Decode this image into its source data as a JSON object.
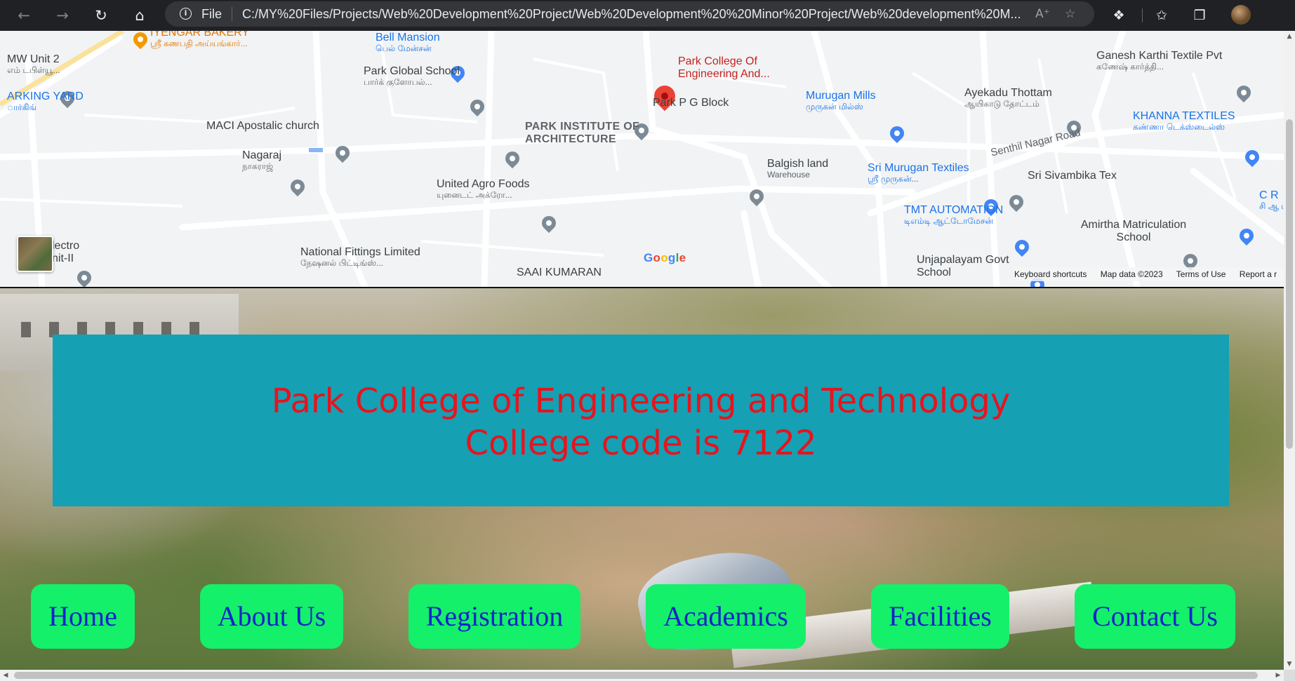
{
  "browser": {
    "scheme": "File",
    "url": "C:/MY%20Files/Projects/Web%20Development%20Project/Web%20Development%20%20Minor%20Project/Web%20development%20M...",
    "icons": [
      "back-icon",
      "forward-icon",
      "refresh-icon",
      "home-icon",
      "info-icon",
      "read-aloud-icon",
      "add-favorite-icon",
      "extensions-icon",
      "favorites-icon",
      "collections-icon",
      "profile-avatar"
    ]
  },
  "map": {
    "places": [
      {
        "name": "IYENGAR BAKERY",
        "sub": "ஸ்ரீ கணபதி அய்யங்கார்..."
      },
      {
        "name": "MW Unit 2",
        "sub": "எம் டபிள்யூ..."
      },
      {
        "name": "ARKING YARD",
        "sub": "ார்கிங்"
      },
      {
        "name": "Bell Mansion",
        "sub": "பெல் மேன்சன்"
      },
      {
        "name": "Park Global School",
        "sub": "பார்க் குளோபல்..."
      },
      {
        "name": "MACI Apostalic church",
        "sub": ""
      },
      {
        "name": "Nagaraj",
        "sub": "நாகராஜ்"
      },
      {
        "name": "PARK INSTITUTE OF ARCHITECTURE",
        "sub": ""
      },
      {
        "name": "United Agro Foods",
        "sub": "யுனைடட் அக்ரோ..."
      },
      {
        "name": "National Fittings Limited",
        "sub": "நேஷனல் பிட்டிங்ஸ்..."
      },
      {
        "name": "SAAI KUMARAN",
        "sub": ""
      },
      {
        "name": "Park College Of Engineering And...",
        "sub": ""
      },
      {
        "name": "Park P G Block",
        "sub": ""
      },
      {
        "name": "Murugan Mills",
        "sub": "முருகன் மில்ஸ்"
      },
      {
        "name": "Balgish land",
        "sub": "Warehouse"
      },
      {
        "name": "Sri Murugan Textiles",
        "sub": "ஸ்ரீ முருகன்..."
      },
      {
        "name": "TMT AUTOMATION",
        "sub": "டிஎம்டி ஆட்டோமேசன்"
      },
      {
        "name": "Unjapalayam Govt School",
        "sub": ""
      },
      {
        "name": "Ayekadu Thottam",
        "sub": "ஆயிகாடு தோட்டம்"
      },
      {
        "name": "Sri Sivambika Tex",
        "sub": ""
      },
      {
        "name": "Ganesh Karthi Textile Pvt",
        "sub": "கணேஷ் கார்த்தி..."
      },
      {
        "name": "KHANNA TEXTILES",
        "sub": "கண்ணா டெக்ஸ்டைல்ஸ்"
      },
      {
        "name": "Amirtha Matriculation School",
        "sub": ""
      },
      {
        "name": "C R",
        "sub": "சி ஆ மில்"
      },
      {
        "name": "lectro nit-II",
        "sub": ""
      }
    ],
    "road_label": "Senthil Nagar Road",
    "logo": "Google",
    "attribution": [
      "Keyboard shortcuts",
      "Map data ©2023",
      "Terms of Use",
      "Report a r"
    ]
  },
  "hero": {
    "title_line1": "Park College of Engineering and Technology",
    "title_line2": "College code is 7122"
  },
  "nav": [
    "Home",
    "About Us",
    "Registration",
    "Academics",
    "Facilities",
    "Contact Us"
  ],
  "colors": {
    "banner_bg": "#15a0b4",
    "title_text": "#e8131d",
    "nav_bg": "#14f06a",
    "nav_text": "#1524c8",
    "map_bg": "#f1f3f4"
  }
}
